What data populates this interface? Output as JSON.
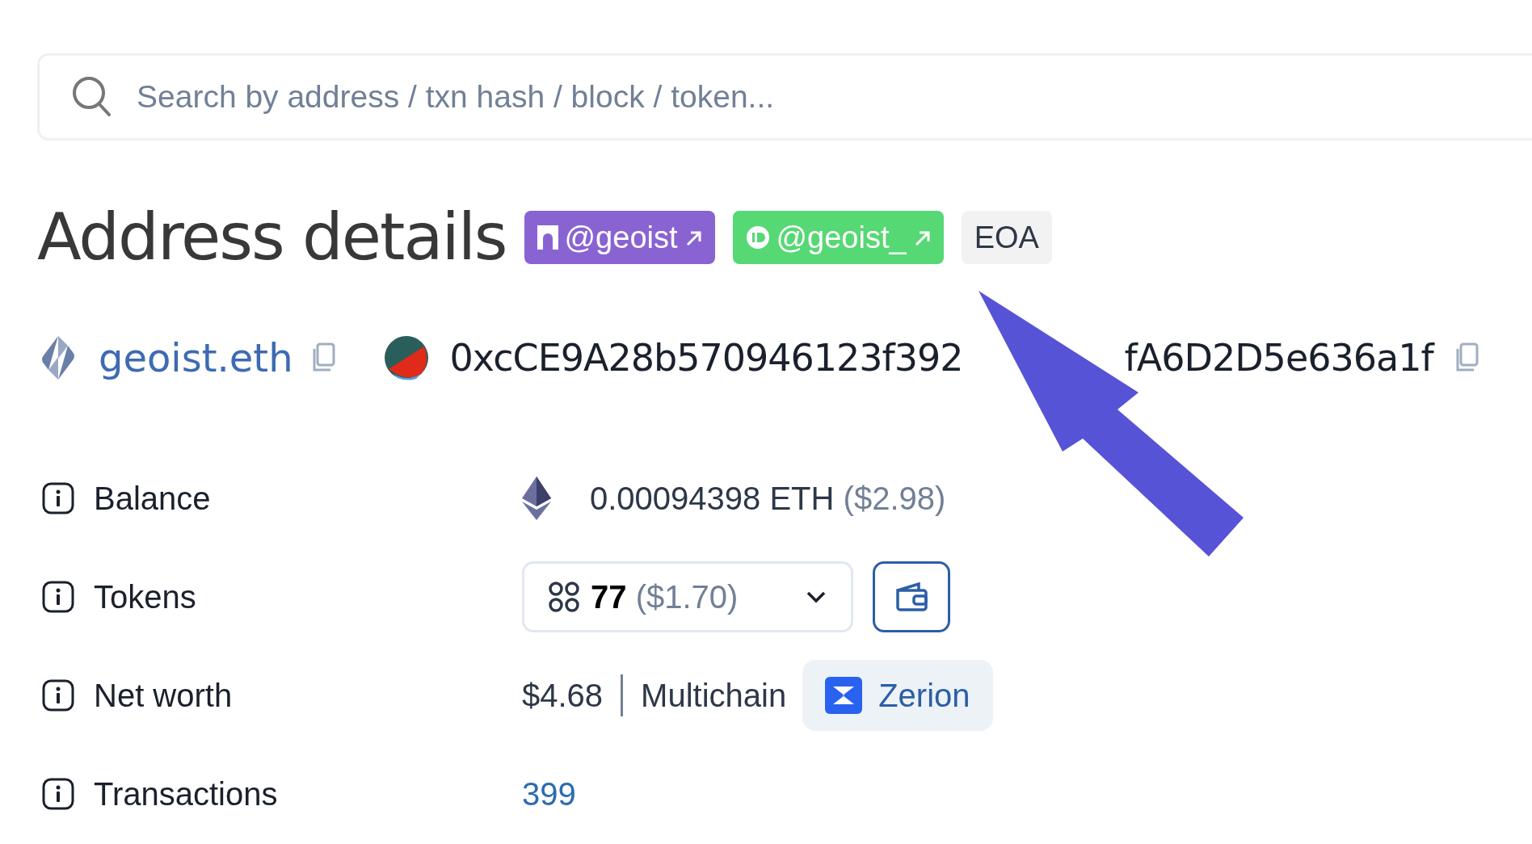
{
  "search": {
    "placeholder": "Search by address / txn hash / block / token..."
  },
  "header": {
    "title": "Address details",
    "tags": [
      {
        "kind": "farcaster",
        "text": "@geoist"
      },
      {
        "kind": "id",
        "text": "@geoist_"
      },
      {
        "kind": "plain",
        "text": "EOA"
      }
    ]
  },
  "identity": {
    "ens_name": "geoist.eth",
    "address_visible_start": "0xcCE9A28b570946123f392",
    "address_visible_end": "fA6D2D5e636a1f"
  },
  "details": [
    {
      "kind": "balance",
      "label": "Balance",
      "value": "0.00094398 ETH",
      "extra": "($2.98)"
    },
    {
      "kind": "tokens",
      "label": "Tokens",
      "value": "77",
      "extra": "($1.70)"
    },
    {
      "kind": "networth",
      "label": "Net worth",
      "value": "$4.68",
      "extra": "Multichain",
      "link": "Zerion"
    },
    {
      "kind": "link",
      "label": "Transactions",
      "value": "399"
    }
  ]
}
